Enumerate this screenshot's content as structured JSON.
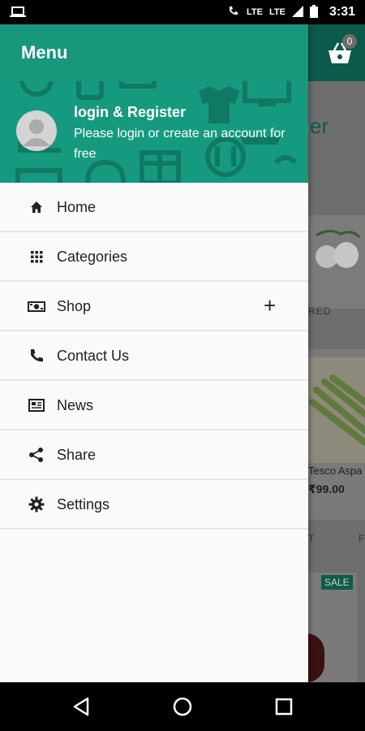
{
  "status_bar": {
    "time": "3:31",
    "network1": "LTE",
    "network2": "LTE",
    "icons": [
      "laptop-icon",
      "wifi-calling-icon",
      "signal-icon",
      "battery-icon"
    ]
  },
  "drawer": {
    "title": "Menu",
    "header": {
      "login_title": "login & Register",
      "login_subtitle": "Please login or create an account for free"
    },
    "items": [
      {
        "label": "Home",
        "icon": "home-icon"
      },
      {
        "label": "Categories",
        "icon": "grid-icon"
      },
      {
        "label": "Shop",
        "icon": "money-icon",
        "expand": "+"
      },
      {
        "label": "Contact Us",
        "icon": "phone-icon"
      },
      {
        "label": "News",
        "icon": "newspaper-icon"
      },
      {
        "label": "Share",
        "icon": "share-icon"
      },
      {
        "label": "Settings",
        "icon": "gear-icon"
      }
    ]
  },
  "background": {
    "cart_count": "0",
    "heading_fragment": "er",
    "featured_fragment": "RED",
    "product_name": "Tesco Aspa",
    "product_price": "₹99.00",
    "tab_fragment_1": "T",
    "tab_fragment_2": "F",
    "sale_badge": "SALE"
  },
  "colors": {
    "accent": "#169a7f",
    "toolbar": "#17977c",
    "drawer_bg": "#fafafa",
    "divider": "#e6e6e6",
    "text": "#212121"
  }
}
